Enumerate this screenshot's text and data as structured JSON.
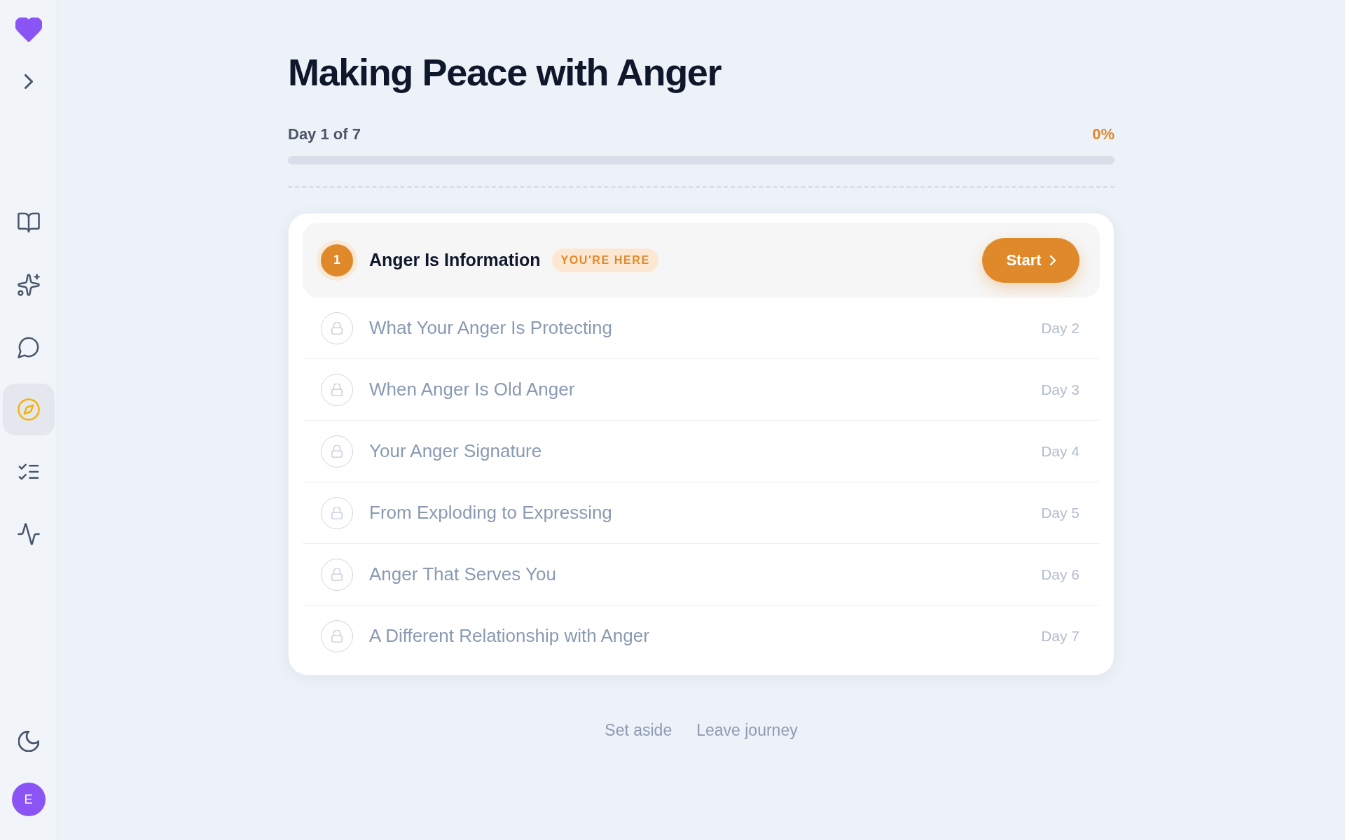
{
  "sidebar": {
    "nav_items": [
      {
        "selected": false
      },
      {
        "selected": false
      },
      {
        "selected": false
      },
      {
        "selected": true
      },
      {
        "selected": false
      },
      {
        "selected": false
      }
    ],
    "avatar": {
      "initial": "E"
    }
  },
  "journey": {
    "title": "Making Peace with Anger",
    "progress": {
      "label": "Day 1 of 7",
      "percent": "0%",
      "level": 0
    },
    "lessons": [
      {
        "kind": "current",
        "number": "1",
        "title": "Anger Is Information",
        "badge": "YOU'RE HERE",
        "button": "Start"
      },
      {
        "kind": "locked",
        "title": "What Your Anger Is Protecting",
        "day": "Day 2"
      },
      {
        "kind": "locked",
        "title": "When Anger Is Old Anger",
        "day": "Day 3"
      },
      {
        "kind": "locked",
        "title": "Your Anger Signature",
        "day": "Day 4"
      },
      {
        "kind": "locked",
        "title": "From Exploding to Expressing",
        "day": "Day 5"
      },
      {
        "kind": "locked",
        "title": "Anger That Serves You",
        "day": "Day 6"
      },
      {
        "kind": "locked",
        "title": "A Different Relationship with Anger",
        "day": "Day 7"
      }
    ],
    "actions": [
      "Set aside",
      "Leave journey"
    ]
  }
}
